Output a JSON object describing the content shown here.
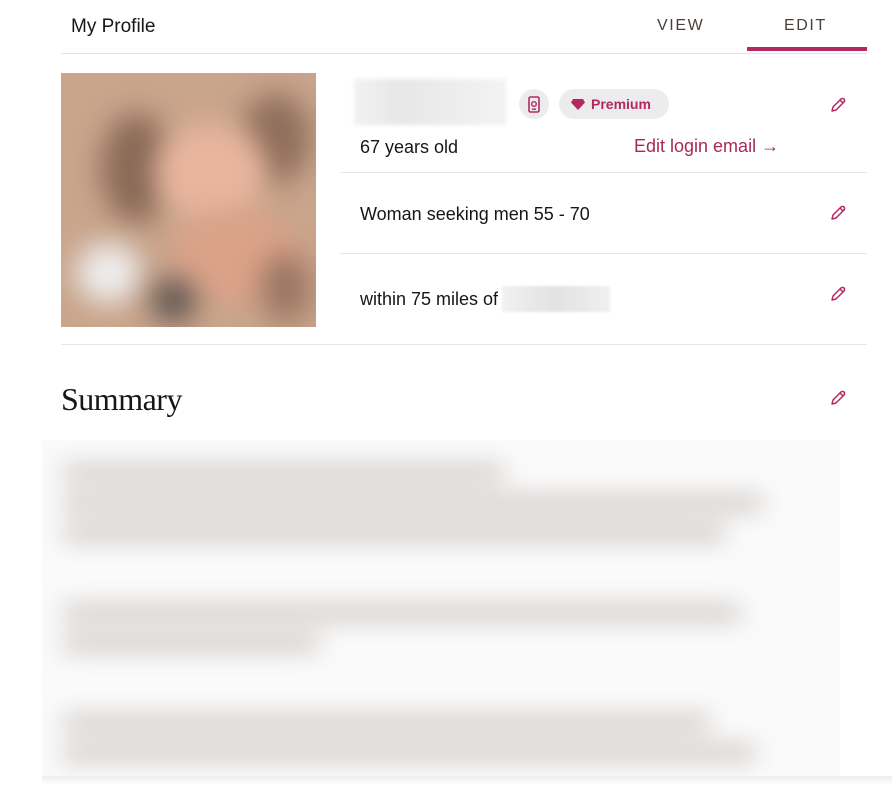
{
  "header": {
    "title": "My Profile",
    "tabs": [
      {
        "label": "VIEW",
        "active": false
      },
      {
        "label": "EDIT",
        "active": true
      }
    ]
  },
  "profile": {
    "photo": {
      "alt": "profile-photo (blurred)"
    },
    "name": "(blurred)",
    "verified_icon": "phone-verified-icon",
    "badge": {
      "icon": "gem-icon",
      "label": "Premium"
    },
    "age_text": "67 years old",
    "edit_login_email": "Edit login email →",
    "seeking_text": "Woman seeking men 55 - 70",
    "location_prefix": "within 75 miles of",
    "location_value": "(blurred)"
  },
  "summary": {
    "title": "Summary",
    "body": "(blurred text)"
  },
  "colors": {
    "accent": "#b3285e",
    "badge_bg": "#ececec",
    "divider": "#e6e6e6"
  }
}
